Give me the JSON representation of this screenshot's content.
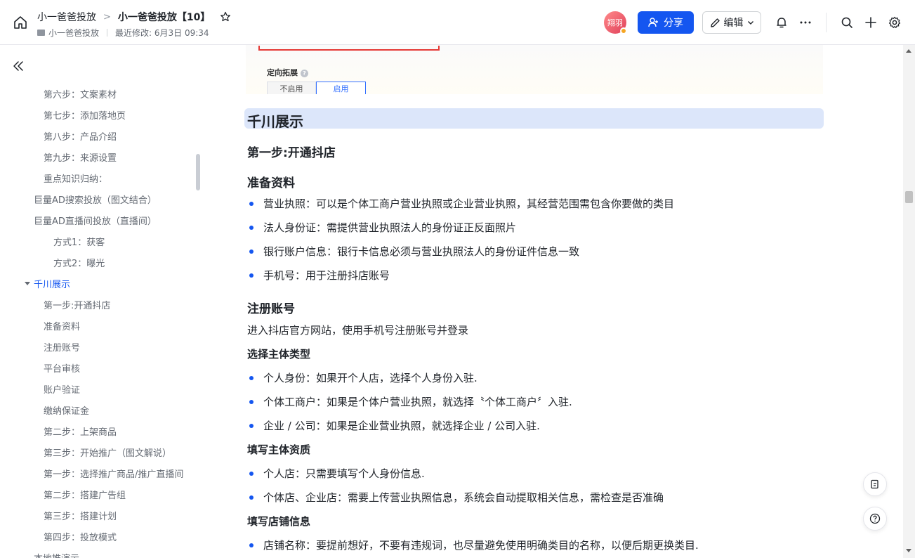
{
  "header": {
    "breadcrumb_parent": "小一爸爸投放",
    "breadcrumb_separator": ">",
    "doc_title": "小一爸爸投放【10】",
    "location": "小一爸爸投放",
    "last_modified": "最近修改: 6月3日 09:34",
    "avatar_text": "翔羽",
    "share_label": "分享",
    "edit_label": "编辑"
  },
  "sidebar": {
    "items": [
      {
        "label": "第六步：文案素材"
      },
      {
        "label": "第七步：添加落地页"
      },
      {
        "label": "第八步：产品介绍"
      },
      {
        "label": "第九步：来源设置"
      },
      {
        "label": "重点知识归纳："
      },
      {
        "label": "巨量AD搜索投放（图文结合）"
      },
      {
        "label": "巨量AD直播间投放（直播间）"
      },
      {
        "label": "方式1：获客"
      },
      {
        "label": "方式2：曝光"
      },
      {
        "label": "千川展示"
      },
      {
        "label": "第一步:开通抖店"
      },
      {
        "label": "准备资料"
      },
      {
        "label": "注册账号"
      },
      {
        "label": "平台审核"
      },
      {
        "label": "账户验证"
      },
      {
        "label": "缴纳保证金"
      },
      {
        "label": "第二步：上架商品"
      },
      {
        "label": "第三步：开始推广（图文解说）"
      },
      {
        "label": "第一步：选择推广商品/推广直播间"
      },
      {
        "label": "第二步：搭建广告组"
      },
      {
        "label": "第三步：搭建计划"
      },
      {
        "label": "第四步：投放模式"
      },
      {
        "label": "本地推演示"
      }
    ]
  },
  "image": {
    "section_label": "定向拓展",
    "option_off": "不启用",
    "option_on": "启用"
  },
  "doc": {
    "h1": "千川展示",
    "step1": "第一步:开通抖店",
    "prep_title": "准备资料",
    "prep_items": [
      "营业执照：可以是个体工商户营业执照或企业营业执照，其经营范围需包含你要做的类目",
      "法人身份证：需提供营业执照法人的身份证正反面照片",
      "银行账户信息：银行卡信息必须与营业执照法人的身份证件信息一致",
      "手机号：用于注册抖店账号"
    ],
    "register_title": "注册账号",
    "register_text": "进入抖店官方网站，使用手机号注册账号并登录",
    "subject_title": "选择主体类型",
    "subject_items": [
      "个人身份：如果开个人店，选择个人身份入驻.",
      "个体工商户：如果是个体户营业执照，就选择〝个体工商户〞入驻.",
      "企业 / 公司：如果是企业营业执照，就选择企业 / 公司入驻."
    ],
    "qualify_title": "填写主体资质",
    "qualify_items": [
      "个人店：只需要填写个人身份信息.",
      "个体店、企业店：需要上传营业执照信息，系统会自动提取相关信息，需检查是否准确"
    ],
    "shop_title": "填写店铺信息",
    "shop_items": [
      "店铺名称：要提前想好，不要有违规词，也尽量避免使用明确类目的名称，以便后期更换类目."
    ]
  },
  "colors": {
    "accent": "#1456f0",
    "heading_band": "#dce6fa"
  }
}
